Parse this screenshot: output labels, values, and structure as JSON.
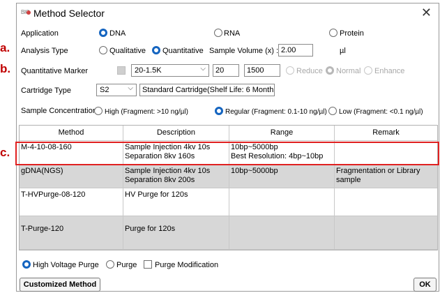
{
  "callouts": [
    "a.",
    "b.",
    "c."
  ],
  "window": {
    "logo": "BIO",
    "title": "Method Selector",
    "close": "✕"
  },
  "application": {
    "label": "Application",
    "options": [
      "DNA",
      "RNA",
      "Protein"
    ],
    "selected": "DNA"
  },
  "analysis": {
    "label": "Analysis Type",
    "options": [
      "Qualitative",
      "Quantitative"
    ],
    "selected": "Quantitative",
    "volume_label": "Sample Volume (x) :",
    "volume_value": "2.00",
    "volume_unit": "µl"
  },
  "marker": {
    "label": "Quantitative Marker",
    "select_value": "20-1.5K",
    "from_value": "20",
    "to_value": "1500",
    "options": [
      "Reduce",
      "Normal",
      "Enhance"
    ],
    "selected": "Normal"
  },
  "cartridge": {
    "label": "Cartridge Type",
    "select_value": "S2",
    "description": "Standard Cartridge(Shelf Life: 6 Months)"
  },
  "concentration": {
    "label": "Sample Concentration",
    "options": [
      "High (Fragment: >10 ng/µl)",
      "Regular (Fragment: 0.1-10 ng/µl)",
      "Low (Fragment: <0.1 ng/µl)"
    ],
    "selected": "Regular (Fragment: 0.1-10 ng/µl)"
  },
  "table": {
    "headers": [
      "Method",
      "Description",
      "Range",
      "Remark"
    ],
    "rows": [
      {
        "method": "M-4-10-08-160",
        "description": [
          "Sample Injection 4kv 10s",
          "Separation 8kv 160s"
        ],
        "range": [
          "10bp~5000bp",
          "Best Resolution: 4bp~10bp"
        ],
        "remark": [
          "",
          ""
        ]
      },
      {
        "method": "gDNA(NGS)",
        "description": [
          "Sample Injection 4kv 10s",
          "Separation 8kv 200s"
        ],
        "range": [
          "10bp~5000bp",
          ""
        ],
        "remark": [
          "Fragmentation or Library",
          "sample"
        ]
      },
      {
        "method": "T-HVPurge-08-120",
        "description": [
          "HV Purge for 120s",
          ""
        ],
        "range": [
          "",
          ""
        ],
        "remark": [
          "",
          ""
        ]
      },
      {
        "method": "T-Purge-120",
        "description": [
          "Purge for 120s",
          ""
        ],
        "range": [
          "",
          ""
        ],
        "remark": [
          "",
          ""
        ]
      }
    ]
  },
  "purge": {
    "options": [
      "High Voltage Purge",
      "Purge"
    ],
    "selected": "High Voltage Purge",
    "modification_label": "Purge Modification"
  },
  "buttons": {
    "customized": "Customized Method",
    "ok": "OK"
  },
  "colors": {
    "accent": "#1565c0",
    "highlight": "#e02020",
    "callout": "#c00000",
    "row_shade": "#d7d7d7"
  }
}
